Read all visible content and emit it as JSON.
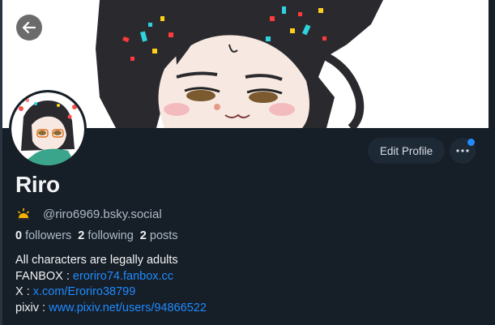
{
  "profile": {
    "display_name": "Riro",
    "handle": "@riro6969.bsky.social",
    "handle_icon": "sunrise-icon"
  },
  "stats": {
    "followers_count": "0",
    "followers_label": "followers",
    "following_count": "2",
    "following_label": "following",
    "posts_count": "2",
    "posts_label": "posts"
  },
  "bio": {
    "line1": "All characters are legally adults",
    "fanbox_label": "FANBOX : ",
    "fanbox_link": "eroriro74.fanbox.cc",
    "x_label": "X : ",
    "x_link": "x.com/Eroriro38799",
    "pixiv_label": "pixiv : ",
    "pixiv_link": "www.pixiv.net/users/94866522"
  },
  "actions": {
    "edit_profile": "Edit Profile",
    "more_icon": "ellipsis-icon",
    "back_icon": "arrow-left-icon"
  },
  "colors": {
    "background": "#161e27",
    "link": "#208bfe",
    "muted_text": "#aebbc9",
    "button_bg": "#1e2936",
    "notification_dot": "#208bfe"
  }
}
